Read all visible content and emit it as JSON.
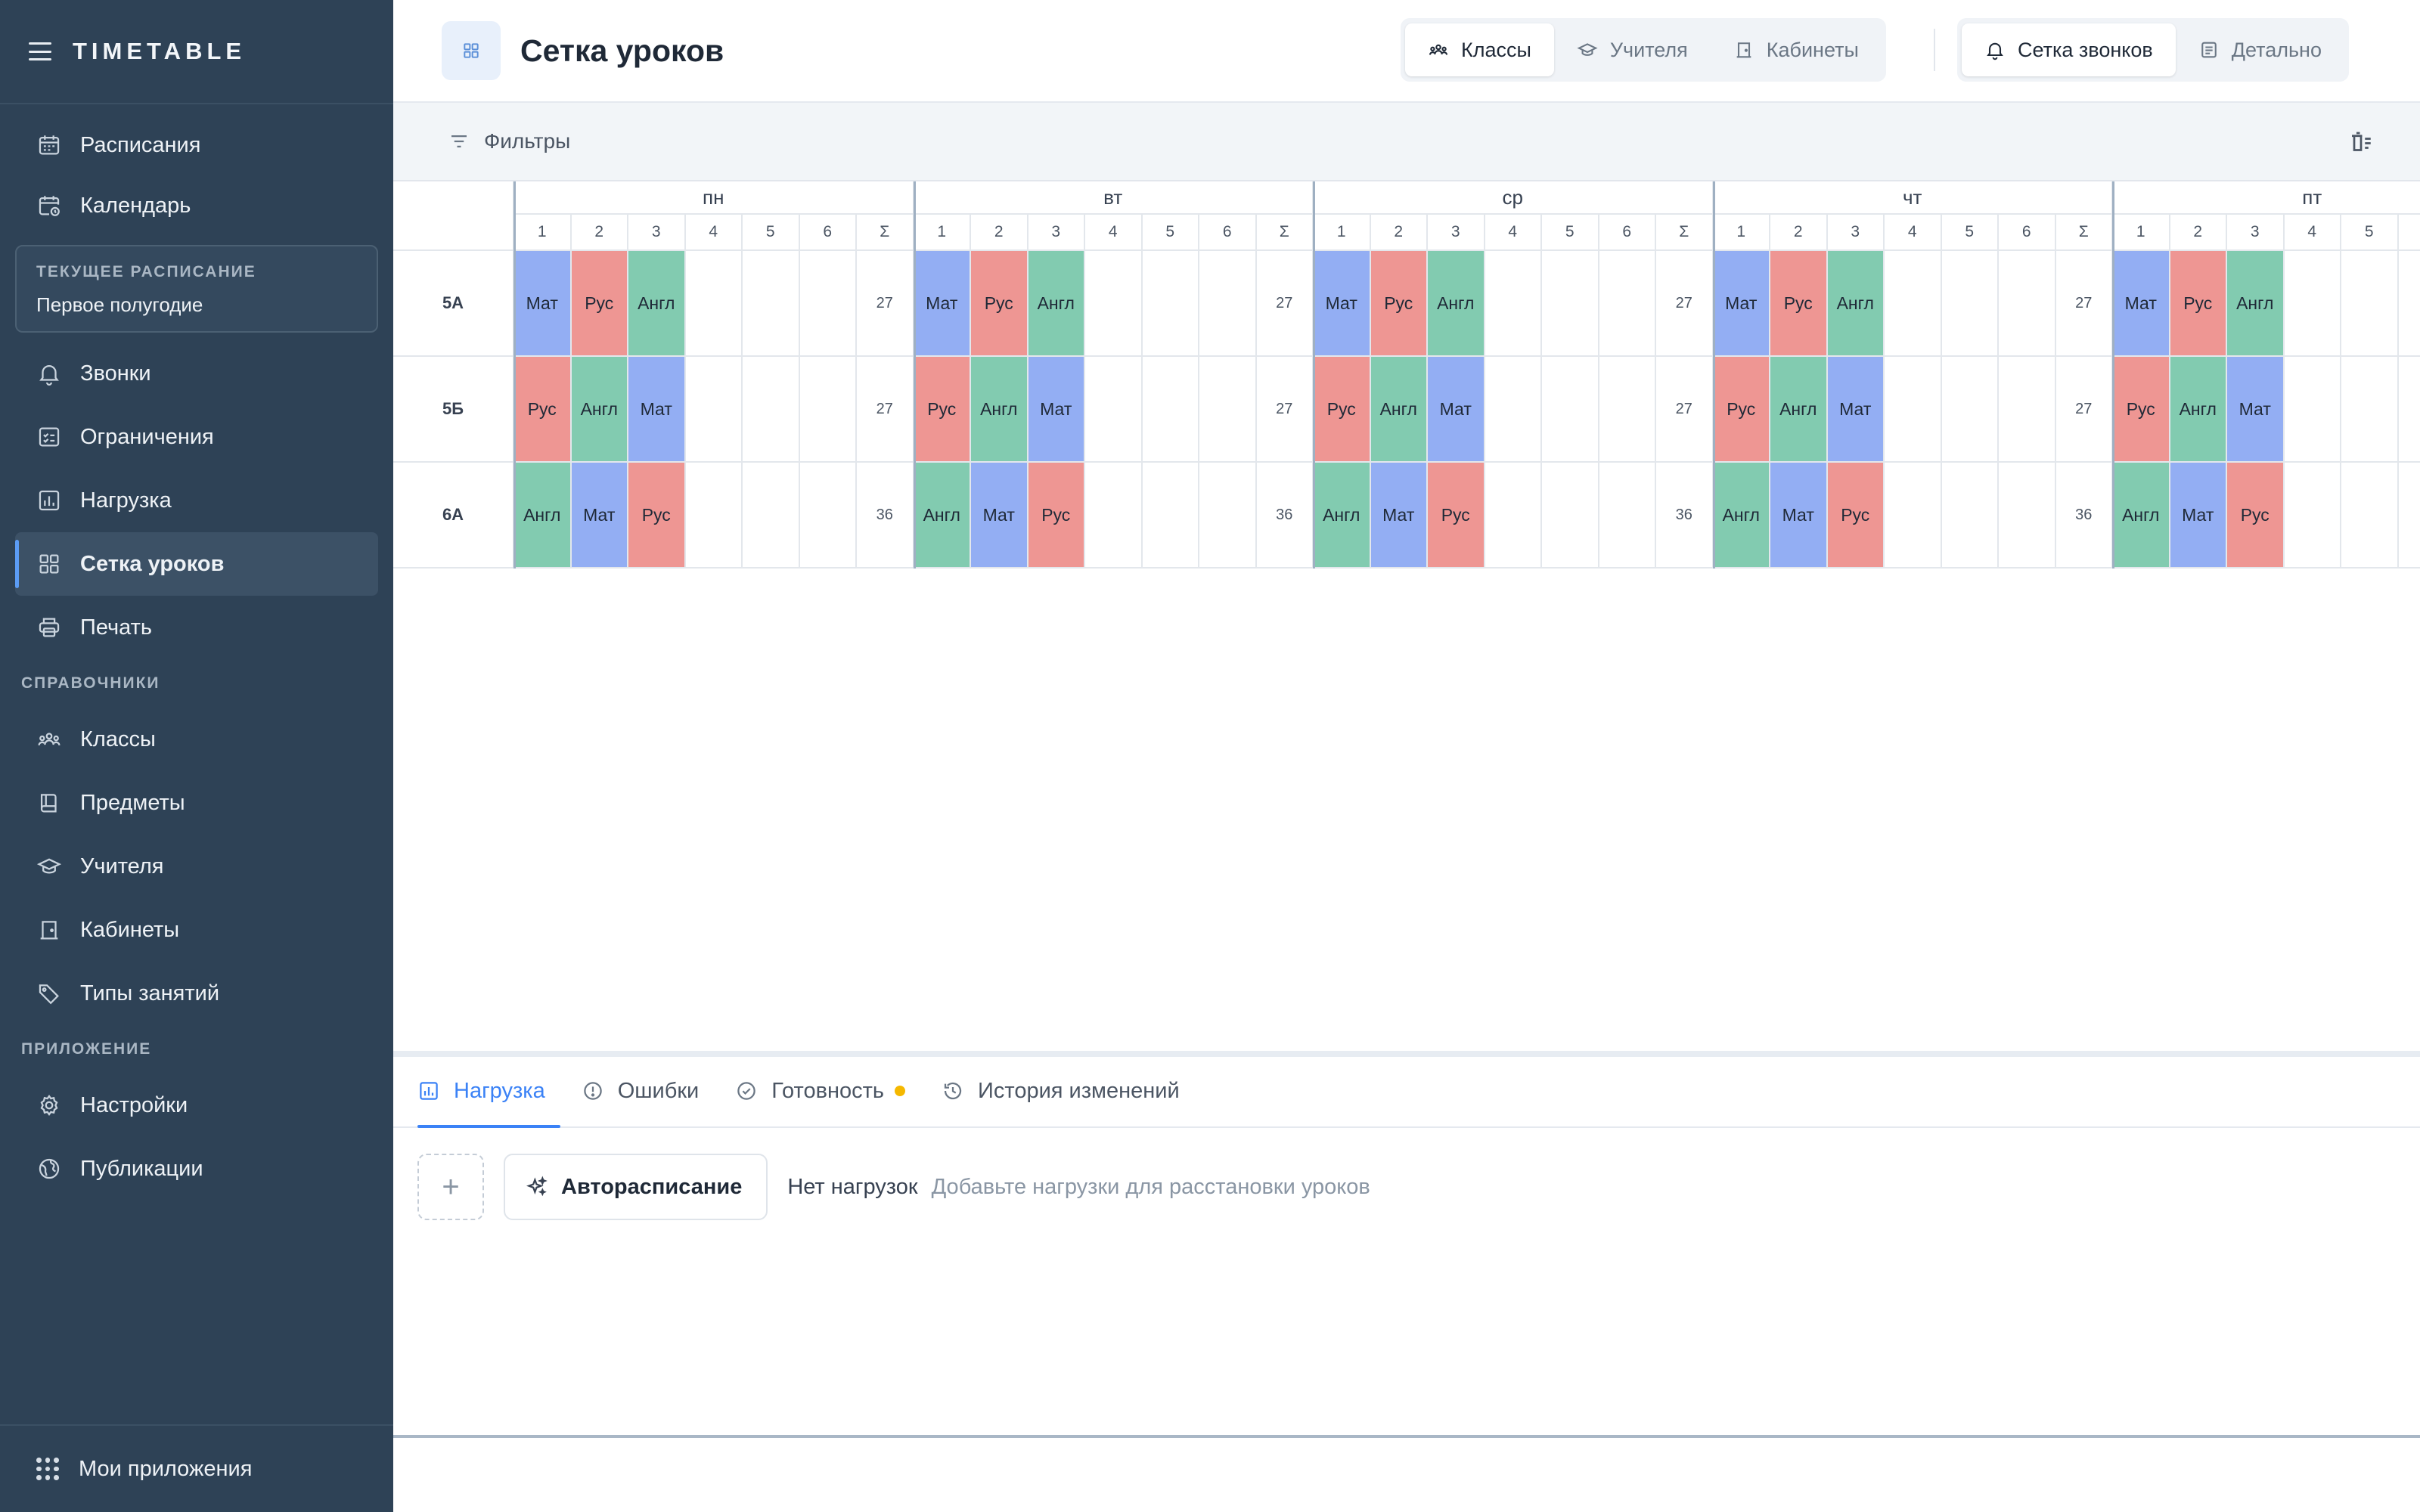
{
  "app": {
    "title": "TIMETABLE"
  },
  "sidebar": {
    "top_items": [
      {
        "label": "Расписания",
        "icon": "calendar-icon"
      },
      {
        "label": "Календарь",
        "icon": "calendar-clock-icon"
      }
    ],
    "current_schedule": {
      "label": "ТЕКУЩЕЕ РАСПИСАНИЕ",
      "value": "Первое полугодие"
    },
    "schedule_items": [
      {
        "label": "Звонки",
        "icon": "bell-icon"
      },
      {
        "label": "Ограничения",
        "icon": "checklist-icon"
      },
      {
        "label": "Нагрузка",
        "icon": "bar-chart-icon"
      },
      {
        "label": "Сетка уроков",
        "icon": "grid-icon",
        "active": true
      },
      {
        "label": "Печать",
        "icon": "printer-icon"
      }
    ],
    "reference_label": "СПРАВОЧНИКИ",
    "reference_items": [
      {
        "label": "Классы",
        "icon": "people-icon"
      },
      {
        "label": "Предметы",
        "icon": "book-icon"
      },
      {
        "label": "Учителя",
        "icon": "graduation-cap-icon"
      },
      {
        "label": "Кабинеты",
        "icon": "door-icon"
      },
      {
        "label": "Типы занятий",
        "icon": "tag-icon"
      }
    ],
    "app_label": "ПРИЛОЖЕНИЕ",
    "app_items": [
      {
        "label": "Настройки",
        "icon": "gear-icon"
      },
      {
        "label": "Публикации",
        "icon": "globe-icon"
      }
    ],
    "bottom": {
      "label": "Мои приложения",
      "icon": "apps-grid-icon"
    }
  },
  "header": {
    "title": "Сетка уроков",
    "view_tabs": [
      {
        "label": "Классы",
        "icon": "people-icon",
        "selected": true
      },
      {
        "label": "Учителя",
        "icon": "graduation-cap-icon",
        "selected": false
      },
      {
        "label": "Кабинеты",
        "icon": "door-icon",
        "selected": false
      }
    ],
    "mode_tabs": [
      {
        "label": "Сетка звонков",
        "icon": "bell-icon",
        "selected": true
      },
      {
        "label": "Детально",
        "icon": "list-icon",
        "selected": false
      }
    ]
  },
  "filters": {
    "label": "Фильтры"
  },
  "grid": {
    "days": [
      "пн",
      "вт",
      "ср",
      "чт",
      "пт"
    ],
    "slots": [
      "1",
      "2",
      "3",
      "4",
      "5",
      "6",
      "Σ"
    ],
    "subject_colors": {
      "Мат": "#93aef3",
      "Рус": "#ee9693",
      "Англ": "#82cbb0"
    },
    "rows": [
      {
        "class": "5А",
        "lessons": [
          "Мат",
          "Рус",
          "Англ"
        ],
        "sum": "27"
      },
      {
        "class": "5Б",
        "lessons": [
          "Рус",
          "Англ",
          "Мат"
        ],
        "sum": "27"
      },
      {
        "class": "6А",
        "lessons": [
          "Англ",
          "Мат",
          "Рус"
        ],
        "sum": "36"
      }
    ]
  },
  "bottom_panel": {
    "tabs": [
      {
        "label": "Нагрузка",
        "icon": "bar-chart-icon",
        "active": true
      },
      {
        "label": "Ошибки",
        "icon": "alert-circle-icon"
      },
      {
        "label": "Готовность",
        "icon": "check-circle-icon",
        "dot": true
      },
      {
        "label": "История изменений",
        "icon": "history-icon"
      }
    ],
    "add_label": "+",
    "auto_button": "Авторасписание",
    "empty_title": "Нет нагрузок",
    "empty_hint": "Добавьте нагрузки для расстановки уроков"
  }
}
